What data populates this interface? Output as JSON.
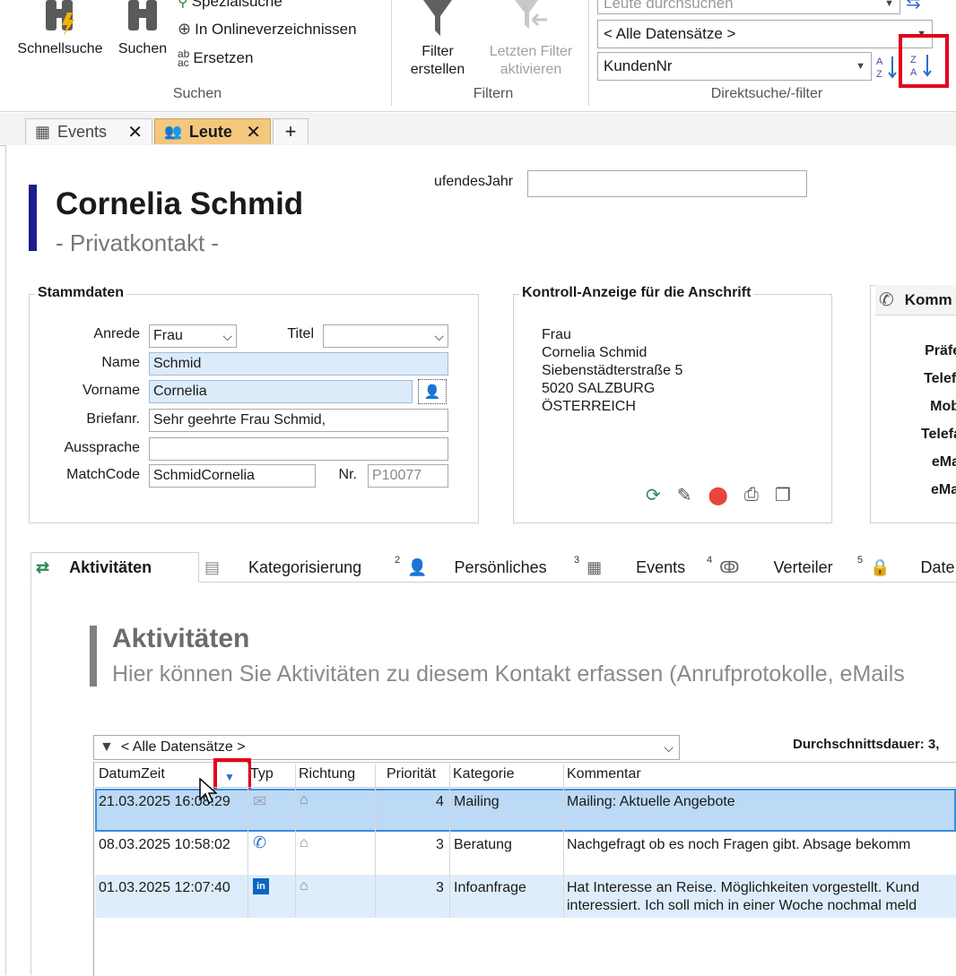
{
  "ribbon": {
    "quick_search": "Schnellsuche",
    "search": "Suchen",
    "special_search": "Spezialsuche",
    "online_dirs": "In Onlineverzeichnissen",
    "replace": "Ersetzen",
    "group_search": "Suchen",
    "filter_create": "Filter erstellen",
    "filter_last": "Letzten Filter aktivieren",
    "group_filter": "Filtern",
    "search_placeholder": "Leute durchsuchen",
    "all_records": "< Alle Datensätze >",
    "sort_field": "KundenNr",
    "group_direct": "Direktsuche/-filter"
  },
  "tabs": [
    {
      "label": "Events"
    },
    {
      "label": "Leute"
    },
    {
      "label": "+"
    }
  ],
  "contact": {
    "name": "Cornelia Schmid",
    "type": "- Privatkontakt -",
    "year_label": "ufendesJahr",
    "year_value": ""
  },
  "stammdaten": {
    "legend": "Stammdaten",
    "anrede_label": "Anrede",
    "anrede_value": "Frau",
    "titel_label": "Titel",
    "titel_value": "",
    "name_label": "Name",
    "name_value": "Schmid",
    "vorname_label": "Vorname",
    "vorname_value": "Cornelia",
    "briefanr_label": "Briefanr.",
    "briefanr_value": "Sehr geehrte Frau Schmid,",
    "aussprache_label": "Aussprache",
    "aussprache_value": "",
    "matchcode_label": "MatchCode",
    "matchcode_value": "SchmidCornelia",
    "nr_label": "Nr.",
    "nr_value": "P10077"
  },
  "address": {
    "legend": "Kontroll-Anzeige für die Anschrift",
    "lines": [
      "Frau",
      "Cornelia Schmid",
      "Siebenstädterstraße 5",
      "5020 SALZBURG",
      "ÖSTERREICH"
    ]
  },
  "komm": {
    "legend": "Komm",
    "labels": [
      "Präferen",
      "Telefo",
      "Mob",
      "Telefa",
      "eMa",
      "eMail"
    ]
  },
  "section_tabs": [
    {
      "label": "Aktivitäten",
      "num": ""
    },
    {
      "label": "Kategorisierung",
      "num": "2"
    },
    {
      "label": "Persönliches",
      "num": "3"
    },
    {
      "label": "Events",
      "num": "4"
    },
    {
      "label": "Verteiler",
      "num": "5"
    },
    {
      "label": "Date",
      "num": ""
    }
  ],
  "activities": {
    "title": "Aktivitäten",
    "subtitle": "Hier können Sie Aktivitäten zu diesem Kontakt erfassen (Anrufprotokolle, eMails",
    "filter_value": "< Alle Datensätze >",
    "avg_duration": "Durchschnittsdauer: 3,",
    "columns": [
      "DatumZeit",
      "Typ",
      "Richtung",
      "Priorität",
      "Kategorie",
      "Kommentar"
    ],
    "rows": [
      {
        "datetime": "21.03.2025 16:08:29",
        "type_icon": "mail-icon",
        "priority": "4",
        "category": "Mailing",
        "comment": "Mailing: Aktuelle Angebote",
        "comment2": ""
      },
      {
        "datetime": "08.03.2025 10:58:02",
        "type_icon": "phone-icon",
        "priority": "3",
        "category": "Beratung",
        "comment": "Nachgefragt ob es noch Fragen gibt. Absage bekomm",
        "comment2": ""
      },
      {
        "datetime": "01.03.2025 12:07:40",
        "type_icon": "linkedin-icon",
        "priority": "3",
        "category": "Infoanfrage",
        "comment": "Hat Interesse an Reise. Möglichkeiten vorgestellt. Kund",
        "comment2": "interessiert. Ich soll mich in einer Woche nochmal meld"
      }
    ]
  },
  "colors": {
    "accent_bar": "#1c1c8c",
    "highlight_red": "#e3001b",
    "selected_row": "#bcd9f5",
    "alt_row": "#deedfb",
    "tab_active": "#f4c77f"
  }
}
